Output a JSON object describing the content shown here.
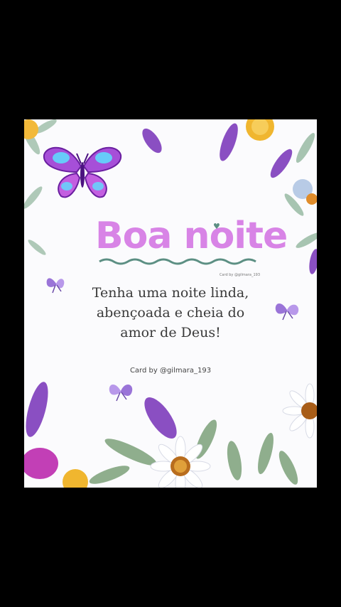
{
  "card": {
    "title": "Boa noite",
    "small_credit": "Card by @gilmara_193",
    "message_lines": [
      "Tenha uma noite linda,",
      "abençoada e cheia do",
      "amor de Deus!"
    ],
    "credit": "Card by @gilmara_193"
  },
  "colors": {
    "background": "#000000",
    "card": "#fbfbfd",
    "title": "#d884e6",
    "accent": "#5c8f83",
    "lavender": "#8a4fc2"
  }
}
